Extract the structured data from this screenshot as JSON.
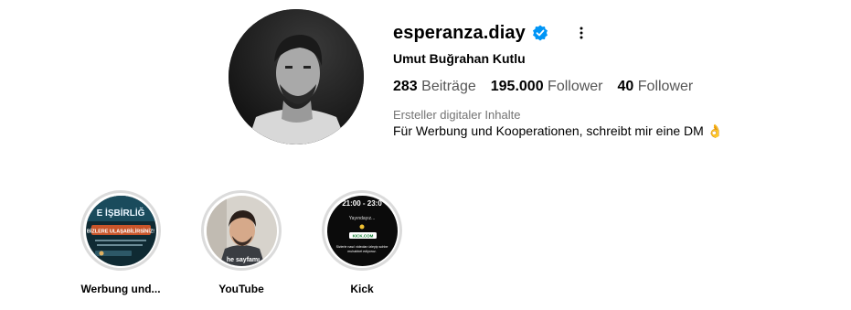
{
  "profile": {
    "username": "esperanza.diay",
    "verified": true,
    "full_name": "Umut Buğrahan Kutlu",
    "stats": [
      {
        "value": "283",
        "label": "Beiträge"
      },
      {
        "value": "195.000",
        "label": "Follower"
      },
      {
        "value": "40",
        "label": "Follower"
      }
    ],
    "category": "Ersteller digitaler Inhalte",
    "bio": "Für Werbung und Kooperationen, schreibt mir eine DM 👌"
  },
  "highlights": [
    {
      "label": "Werbung und...",
      "image_text": [
        "E İŞBİRLİĞ",
        "BİZLERE ULAŞABİLİRSİNİZ!"
      ]
    },
    {
      "label": "YouTube",
      "image_text": [
        "he sayfamı"
      ]
    },
    {
      "label": "Kick",
      "image_text": [
        "21:00 - 23:0",
        "Yayındayız...",
        "KICK.COM",
        "Sizlerle nasıl videoları izleyip sohbe",
        "muhabbet ediyoruz."
      ]
    }
  ],
  "colors": {
    "verified": "#0095f6",
    "ring": "#dbdbdb",
    "muted": "#737373"
  }
}
